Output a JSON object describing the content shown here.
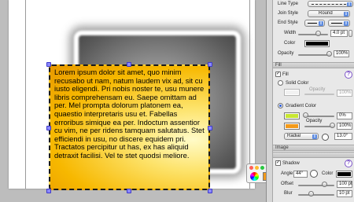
{
  "canvas": {
    "text": "Lorem ipsum dolor sit amet, quo minim recusabo ut nam, natum laudem vix ad, sit cu iusto eligendi. Pri nobis noster te, usu munere libris comprehensam eu. Saepe omittam ad per. Mel prompta dolorum platonem ea, quaestio interpretaris usu et. Fabellas erroribus simique ea per. Indoctum assentior cu vim, ne per ridens tamquam salutatus. Stet efficiendi in usu, no discere equidem pri. Tractatos percipitur ut has, ex has aliquid detraxit facilisi. Vel te stet quodsi meliore."
  },
  "inspector": {
    "line_type_label": "Line Type",
    "join_style_label": "Join Style",
    "join_style_value": "Round",
    "end_style_label": "End Style",
    "width_label": "Width",
    "width_value": "4.0 pt",
    "color_label": "Color",
    "opacity_label": "Opacity",
    "opacity_value": "100%",
    "fill_section": "Fill",
    "fill_checkbox_label": "Fill",
    "solid_color_label": "Solid Color",
    "solid_opacity_label": "Opacity",
    "solid_opacity_value": "100%",
    "gradient_color_label": "Gradient Color",
    "gradient_opacity_label": "Opacity",
    "gradient_opacity_value": "0%",
    "gradient_opacity_value_2": "100%",
    "gradient_type_value": "Radial",
    "gradient_angle_value": "13.0°",
    "image_section": "Image",
    "shadow_section": "Shadow",
    "shadow_checkbox_label": "Shadow",
    "angle_label": "Angle",
    "angle_value": "44°",
    "shadow_color_label": "Color",
    "offset_label": "Offset",
    "offset_value": "100 pt",
    "blur_label": "Blur",
    "blur_value": "10 pt",
    "help_glyph": "?"
  },
  "colors": {
    "gradient_start": "#c8e632",
    "gradient_end": "#f39a1a",
    "line_color": "#000000",
    "shadow_color": "#000000",
    "handle_color": "#8b88ff"
  }
}
